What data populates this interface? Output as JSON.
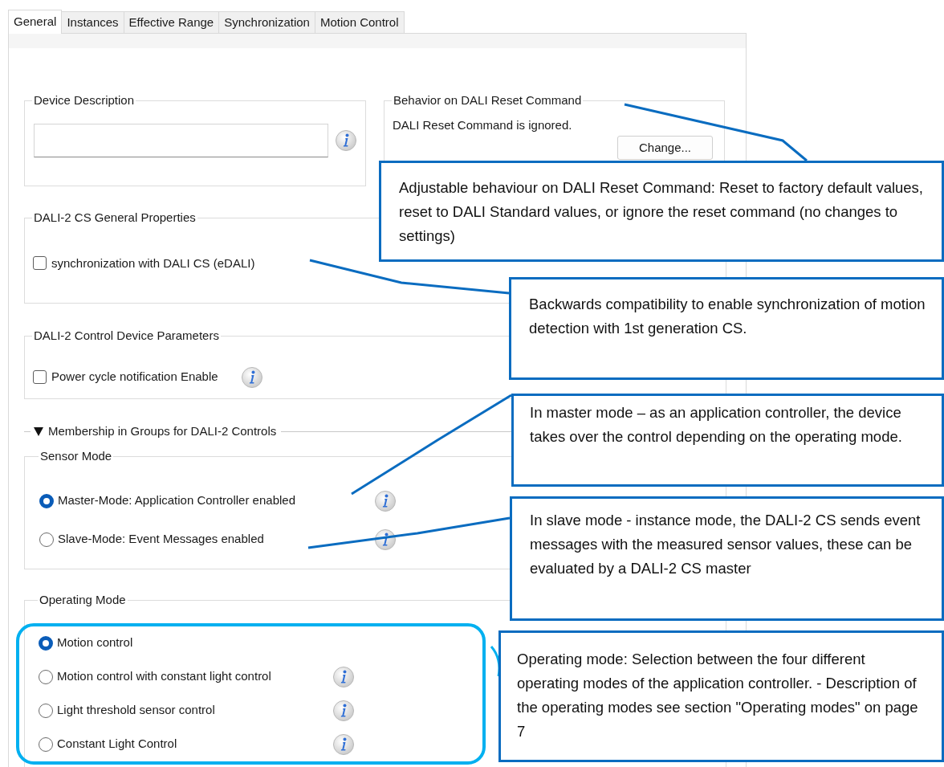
{
  "tabs": [
    {
      "label": "General",
      "selected": true
    },
    {
      "label": "Instances",
      "selected": false
    },
    {
      "label": "Effective Range",
      "selected": false
    },
    {
      "label": "Synchronization",
      "selected": false
    },
    {
      "label": "Motion Control",
      "selected": false
    }
  ],
  "device_description": {
    "title": "Device Description",
    "info": true
  },
  "reset_behavior": {
    "title": "Behavior on DALI Reset Command",
    "text": "DALI Reset Command is ignored.",
    "button": "Change..."
  },
  "cs_general": {
    "title": "DALI-2 CS General Properties",
    "checkbox": {
      "label": "synchronization with DALI CS (eDALI)",
      "checked": false,
      "info": false
    }
  },
  "control_device": {
    "title": "DALI-2 Control Device Parameters",
    "checkbox": {
      "label": "Power cycle notification Enable",
      "checked": false,
      "info": true
    }
  },
  "membership": {
    "label": "Membership in Groups for DALI-2 Controls",
    "expanded": true
  },
  "sensor_mode": {
    "title": "Sensor Mode",
    "options": [
      {
        "label": "Master-Mode: Application Controller enabled",
        "selected": true,
        "info": true
      },
      {
        "label": "Slave-Mode: Event Messages enabled",
        "selected": false,
        "info": true
      }
    ]
  },
  "operating_mode": {
    "title": "Operating Mode",
    "options": [
      {
        "label": "Motion control",
        "selected": true,
        "info": false
      },
      {
        "label": "Motion control with constant light control",
        "selected": false,
        "info": true
      },
      {
        "label": "Light threshold sensor control",
        "selected": false,
        "info": true
      },
      {
        "label": "Constant Light Control",
        "selected": false,
        "info": true
      }
    ]
  },
  "callouts": [
    {
      "text": "Adjustable behaviour on DALI Reset Command: Reset to factory default values, reset to DALI Standard values, or ignore the reset command (no changes to settings)"
    },
    {
      "text": "Backwards compatibility to enable synchronization of motion detection with 1st generation CS."
    },
    {
      "text": "In master mode – as an application controller, the device takes over the control depending on the operating mode."
    },
    {
      "text": "In slave mode - instance mode, the DALI-2 CS sends event messages with the measured sensor values, these can be evaluated by a DALI-2 CS master"
    },
    {
      "text": "Operating mode: Selection between the four different operating modes of the application controller. - Description of the operating modes see section \"Operating modes\" on page 7"
    }
  ]
}
